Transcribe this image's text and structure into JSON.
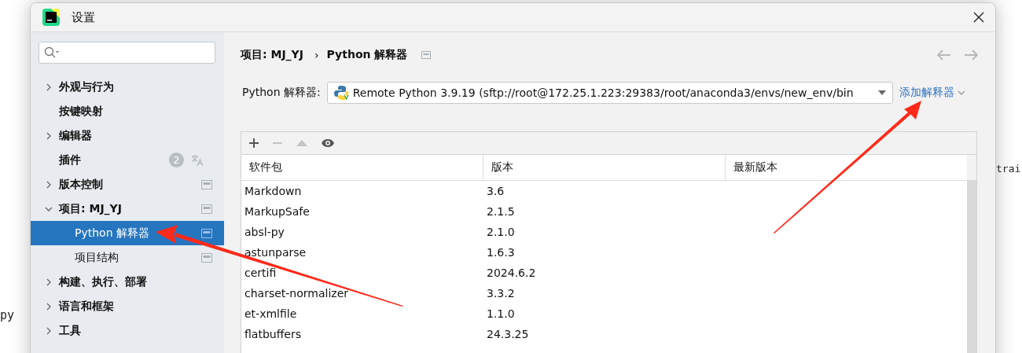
{
  "background_editor": {
    "fragments": [
      "trai",
      "py"
    ]
  },
  "window": {
    "title": "设置"
  },
  "sidebar": {
    "items": [
      {
        "label": "外观与行为",
        "kind": "group",
        "expanded": false,
        "scoped": false
      },
      {
        "label": "按键映射",
        "kind": "leaf",
        "scoped": false
      },
      {
        "label": "编辑器",
        "kind": "group",
        "expanded": false,
        "scoped": false
      },
      {
        "label": "插件",
        "kind": "leaf",
        "scoped": false,
        "badge": "2",
        "translate": true
      },
      {
        "label": "版本控制",
        "kind": "group",
        "expanded": false,
        "scoped": true
      },
      {
        "label": "项目: MJ_YJ",
        "kind": "group",
        "expanded": true,
        "scoped": true,
        "children": [
          {
            "label": "Python 解释器",
            "kind": "leaf",
            "scoped": true,
            "selected": true
          },
          {
            "label": "项目结构",
            "kind": "leaf",
            "scoped": true,
            "selected": false
          }
        ]
      },
      {
        "label": "构建、执行、部署",
        "kind": "group",
        "expanded": false,
        "scoped": false
      },
      {
        "label": "语言和框架",
        "kind": "group",
        "expanded": false,
        "scoped": false
      },
      {
        "label": "工具",
        "kind": "group",
        "expanded": false,
        "scoped": false
      }
    ]
  },
  "breadcrumb": {
    "parent": "项目: MJ_YJ",
    "separator": "›",
    "current": "Python 解释器"
  },
  "interpreter": {
    "label": "Python 解释器:",
    "value": "Remote Python 3.9.19 (sftp://root@172.25.1.223:29383/root/anaconda3/envs/new_env/bin",
    "add_link": "添加解释器"
  },
  "toolbar": [
    {
      "kind": "add",
      "disabled": false
    },
    {
      "kind": "remove",
      "disabled": true
    },
    {
      "kind": "upgrade",
      "disabled": true
    },
    {
      "kind": "show",
      "disabled": false
    }
  ],
  "table": {
    "columns": [
      "软件包",
      "版本",
      "最新版本"
    ],
    "rows": [
      [
        "Markdown",
        "3.6",
        ""
      ],
      [
        "MarkupSafe",
        "2.1.5",
        ""
      ],
      [
        "absl-py",
        "2.1.0",
        ""
      ],
      [
        "astunparse",
        "1.6.3",
        ""
      ],
      [
        "certifi",
        "2024.6.2",
        ""
      ],
      [
        "charset-normalizer",
        "3.3.2",
        ""
      ],
      [
        "et-xmlfile",
        "1.1.0",
        ""
      ],
      [
        "flatbuffers",
        "24.3.25",
        ""
      ]
    ]
  }
}
